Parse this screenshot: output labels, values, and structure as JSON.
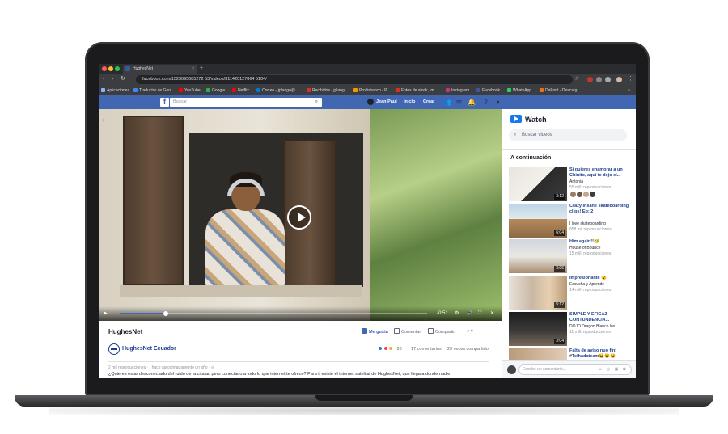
{
  "browser": {
    "tab_title": "HughesNet",
    "tab_close": "×",
    "new_tab": "+",
    "url": "facebook.com/1523695685272 53/videos/311420127864 5104/",
    "nav": {
      "back": "‹",
      "forward": "›",
      "reload": "↻",
      "lock": "🔒",
      "star": "☆",
      "menu": "⋮"
    },
    "bookmarks": [
      {
        "label": "Aplicaciones",
        "color": "#8ab4f8"
      },
      {
        "label": "Traductor de Goo...",
        "color": "#4285f4"
      },
      {
        "label": "YouTube",
        "color": "#ff0000"
      },
      {
        "label": "Google",
        "color": "#34a853"
      },
      {
        "label": "Netflix",
        "color": "#e50914"
      },
      {
        "label": "Correo - jplango@...",
        "color": "#0078d4"
      },
      {
        "label": "Recibidos - jplang...",
        "color": "#d93025"
      },
      {
        "label": "Produbanco / P...",
        "color": "#f29900"
      },
      {
        "label": "Fotos de stock, im...",
        "color": "#d93025"
      },
      {
        "label": "Instagram",
        "color": "#c13584"
      },
      {
        "label": "Facebook",
        "color": "#3b5998"
      },
      {
        "label": "WhatsApp",
        "color": "#25d366"
      },
      {
        "label": "DaFont - Descarg...",
        "color": "#e8711a"
      }
    ],
    "bookmarks_more": "»"
  },
  "fb_header": {
    "logo": "f",
    "search_placeholder": "Buscar",
    "search_icon": "⌕",
    "user_name": "Jean Paul",
    "home": "Inicio",
    "create": "Crear"
  },
  "video": {
    "time_remaining": "-0:51",
    "progress": 0.15,
    "play_icon": "▶"
  },
  "post": {
    "title": "HughesNet",
    "like": "Me gusta",
    "comment": "Comentar",
    "share": "Compartir",
    "more": "···",
    "page_name": "HughesNet Ecuador",
    "reaction_count": "26",
    "comments_count": "17 comentarios",
    "shares_count": "29 veces compartido",
    "meta": "2 mil reproducciones · · hace aproximadamente un año · ◎",
    "description": "¿Quieres estar desconectado del ruido de la ciudad pero conectado a todo lo que internet te ofrece? Para ti existe el internet satelital de HughesNet, que llega a donde nadie"
  },
  "sidebar": {
    "watch_title": "Watch",
    "search_placeholder": "Buscar videos",
    "search_icon": "⌕",
    "up_next_label": "A continuación",
    "items": [
      {
        "title": "Si quieres enamorar a un Chinito, aquí te dejo el...",
        "channel": "Antonia",
        "views": "55 mill. reproducciones",
        "duration": "3:12"
      },
      {
        "title": "Crazy insane skateboarding clips! Ep: 2",
        "channel": "I love skateboarding",
        "views": "858 mil reproducciones",
        "duration": "6:04"
      },
      {
        "title": "Him again!!😂",
        "channel": "House of Bounce",
        "views": "15 mill. reproducciones",
        "duration": "3:06"
      },
      {
        "title": "Impresionante 😮",
        "channel": "Escucha y Aprende",
        "views": "14 mill. reproducciones",
        "duration": "5:12"
      },
      {
        "title": "SIMPLE Y EFICAZ CONTUNDENCIA...",
        "channel": "DOJO Dragon Blanco los...",
        "views": "11 mill. reproducciones",
        "duration": "3:04"
      },
      {
        "title": "Falta de aviso nuo fin! #Telhadateam😂😂😂",
        "channel": "",
        "views": "",
        "duration": ""
      }
    ],
    "comment_placeholder": "Escribe un comentario...",
    "comment_icons": "☺ ◎ ▣ ✿"
  }
}
